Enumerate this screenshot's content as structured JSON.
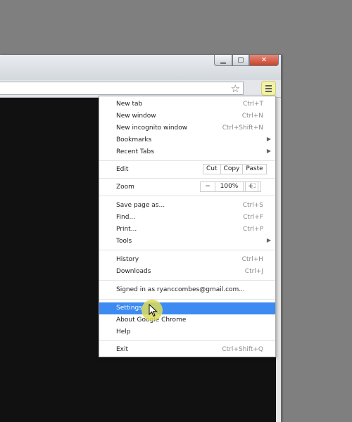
{
  "window": {
    "buttons": {
      "minimize": "▁",
      "maximize": "▢",
      "close": "✕"
    }
  },
  "toolbar": {
    "omnibox_value": "",
    "star_icon": "☆",
    "menu_icon": "hamburger-menu-icon",
    "menu_highlight_color": "#f2f2a4"
  },
  "menu": {
    "new_tab": {
      "label": "New tab",
      "shortcut": "Ctrl+T"
    },
    "new_window": {
      "label": "New window",
      "shortcut": "Ctrl+N"
    },
    "new_incognito": {
      "label": "New incognito window",
      "shortcut": "Ctrl+Shift+N"
    },
    "bookmarks": {
      "label": "Bookmarks",
      "arrow": "▶"
    },
    "recent_tabs": {
      "label": "Recent Tabs",
      "arrow": "▶"
    },
    "edit": {
      "label": "Edit",
      "cut": "Cut",
      "copy": "Copy",
      "paste": "Paste"
    },
    "zoom": {
      "label": "Zoom",
      "minus": "−",
      "value": "100%",
      "plus": "+",
      "fullscreen": "⛶"
    },
    "save_page": {
      "label": "Save page as...",
      "shortcut": "Ctrl+S"
    },
    "find": {
      "label": "Find...",
      "shortcut": "Ctrl+F"
    },
    "print": {
      "label": "Print...",
      "shortcut": "Ctrl+P"
    },
    "tools": {
      "label": "Tools",
      "arrow": "▶"
    },
    "history": {
      "label": "History",
      "shortcut": "Ctrl+H"
    },
    "downloads": {
      "label": "Downloads",
      "shortcut": "Ctrl+J"
    },
    "signed_in": {
      "label": "Signed in as ryanccombes@gmail.com..."
    },
    "settings": {
      "label": "Settings"
    },
    "about": {
      "label": "About Google Chrome"
    },
    "help": {
      "label": "Help"
    },
    "exit": {
      "label": "Exit",
      "shortcut": "Ctrl+Shift+Q"
    }
  },
  "colors": {
    "highlight": "#3c8af2",
    "desktop": "#7f7f7f",
    "page_content": "#111111"
  }
}
